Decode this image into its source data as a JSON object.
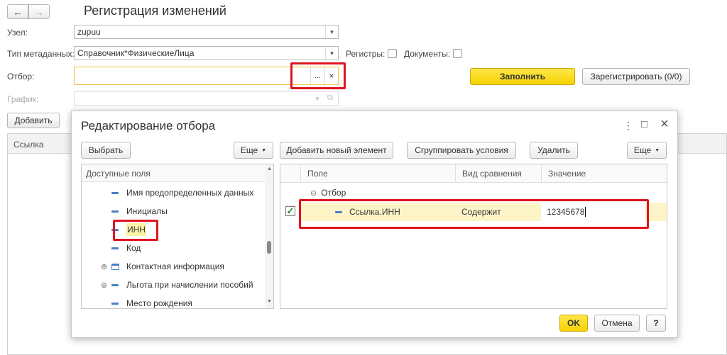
{
  "window": {
    "title": "Регистрация изменений"
  },
  "nav": {
    "back": "←",
    "forward": "→"
  },
  "form": {
    "node_label": "Узел:",
    "node_value": "zupuu",
    "meta_label": "Тип метаданных:",
    "meta_value": "Справочник*ФизическиеЛица",
    "registers_label": "Регистры:",
    "documents_label": "Документы:",
    "filter_label": "Отбор:",
    "filter_value": "",
    "filter_more": "...",
    "filter_clear": "×",
    "schedule_label": "График:",
    "fill_button": "Заполнить",
    "register_button": "Зарегистрировать (0/0)",
    "add_button": "Добавить",
    "link_column": "Ссылка"
  },
  "dialog": {
    "title": "Редактирование отбора",
    "controls": {
      "menu": "⋮",
      "maximize": "□",
      "close": "×"
    },
    "left_toolbar": {
      "select": "Выбрать",
      "more": "Еще"
    },
    "right_toolbar": {
      "add": "Добавить новый элемент",
      "group": "Сгруппировать условия",
      "delete": "Удалить",
      "more": "Еще"
    },
    "available_header": "Доступные поля",
    "fields": [
      "Имя предопределенных данных",
      "Инициалы",
      "ИНН",
      "Код",
      "Контактная информация",
      "Льгота при начислении пособий",
      "Место рождения"
    ],
    "columns": {
      "field": "Поле",
      "compare": "Вид сравнения",
      "value": "Значение"
    },
    "group_row": "Отбор",
    "condition": {
      "field": "Ссылка.ИНН",
      "compare": "Содержит",
      "value": "12345678"
    },
    "ok": "OK",
    "cancel": "Отмена",
    "help": "?"
  }
}
